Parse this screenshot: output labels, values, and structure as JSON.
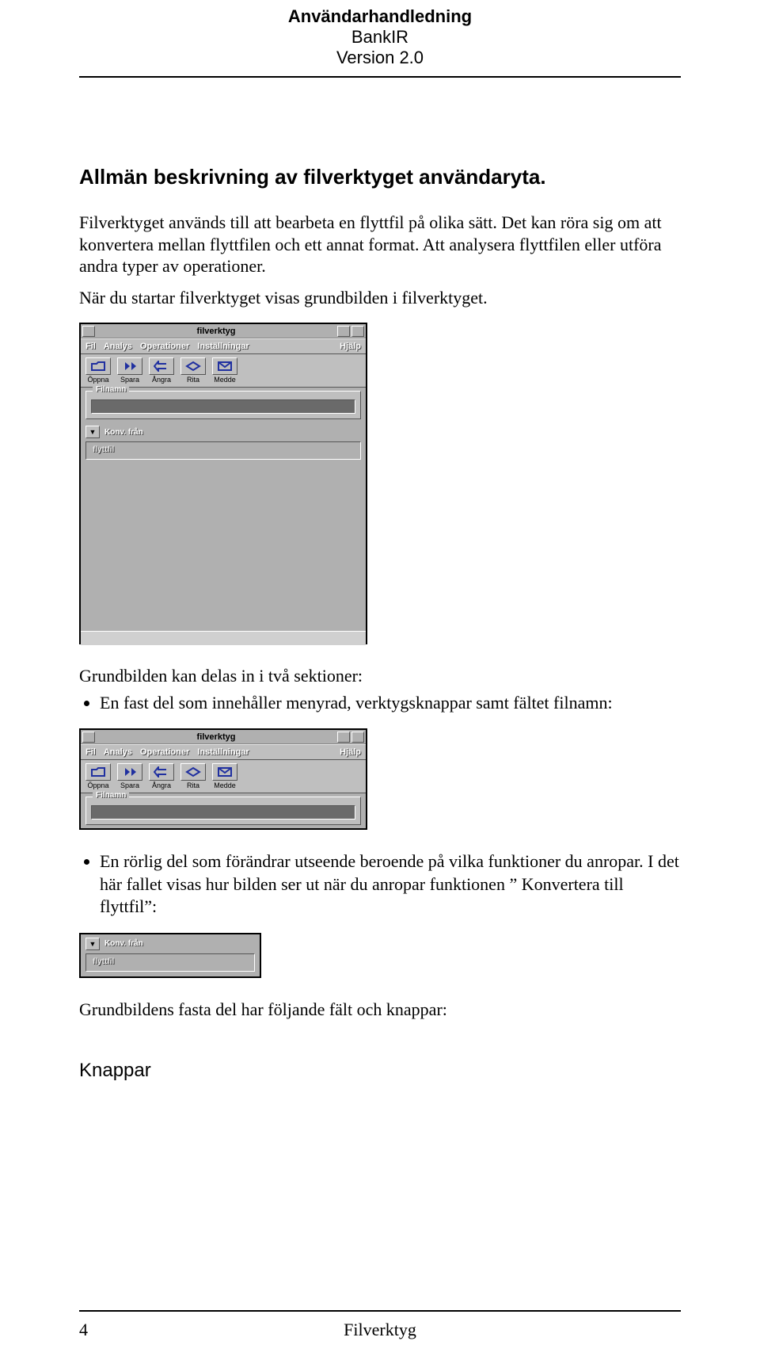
{
  "header": {
    "line1": "Användarhandledning",
    "line2": "BankIR",
    "line3": "Version 2.0"
  },
  "section_title": "Allmän beskrivning av filverktyget användaryta.",
  "para1": "Filverktyget används till att bearbeta en flyttfil på olika sätt. Det kan röra sig om att konvertera mellan flyttfilen och ett annat format. Att analysera flyttfilen eller utföra andra typer av operationer.",
  "para2": "När du startar filverktyget visas grundbilden i filverktyget.",
  "gui": {
    "window_title": "filverktyg",
    "menus": {
      "left": [
        "Fil",
        "Analys",
        "Operationer",
        "Inställningar"
      ],
      "right": "Hjälp"
    },
    "toolbar": [
      {
        "label": "Öppna",
        "icon": "open"
      },
      {
        "label": "Spara",
        "icon": "save"
      },
      {
        "label": "Ångra",
        "icon": "undo"
      },
      {
        "label": "Rita",
        "icon": "draw"
      },
      {
        "label": "Medde",
        "icon": "msg"
      }
    ],
    "filnamn_label": "Filnamn",
    "konv_label": "Konv. från",
    "filetype": "flyttfil"
  },
  "para3": "Grundbilden kan delas in i två sektioner:",
  "bullet1": "En fast del som innehåller menyrad, verktygsknappar samt fältet filnamn:",
  "bullet2": "En rörlig del som förändrar utseende beroende på vilka funktioner du anropar. I det här fallet visas hur bilden ser ut när du anropar funktionen ” Konvertera till flyttfil”:",
  "para4": "Grundbildens fasta del har följande fält och knappar:",
  "subhead": "Knappar",
  "footer": {
    "page_number": "4",
    "center": "Filverktyg"
  }
}
